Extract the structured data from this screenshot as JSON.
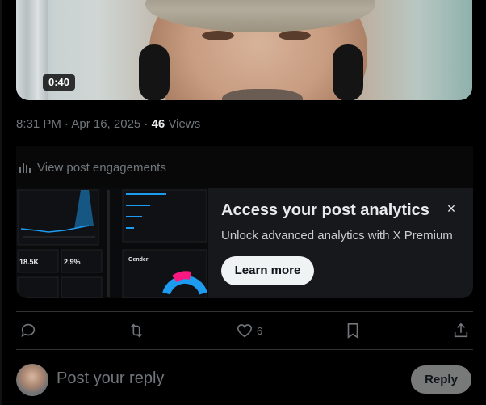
{
  "video": {
    "duration": "0:40"
  },
  "meta": {
    "time": "8:31 PM · Apr 16, 2025 · ",
    "views_count": "46",
    "views_label": " Views"
  },
  "engagements": {
    "label": "View post engagements"
  },
  "promo": {
    "title": "Access your post analytics",
    "subtitle": "Unlock advanced analytics with X Premium",
    "button": "Learn more",
    "close_icon": "×",
    "thumb": {
      "stat_1": "18.5K",
      "stat_2": "2.9%",
      "panel_title": "Gender"
    }
  },
  "actions": {
    "like_count": "6"
  },
  "reply": {
    "placeholder": "Post your reply",
    "button": "Reply"
  },
  "colors": {
    "background": "#000000",
    "muted": "#71767b",
    "text": "#e7e9ea",
    "accent_blue": "#1d9bf0",
    "card": "#16181c"
  }
}
